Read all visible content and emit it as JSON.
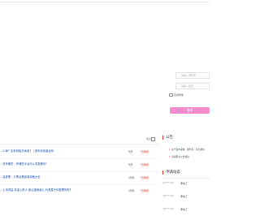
{
  "login": {
    "username_placeholder": "请输入手机号",
    "password_placeholder": "请输入密码",
    "remember_label": "自动登录",
    "login_button": "登录"
  },
  "list": {
    "more_label": "更多",
    "rows": [
      {
        "title": "…么单？如何领取手续费？ | 发布商务撮合网",
        "meta": "",
        "points": "5分",
        "status": "已采纳"
      },
      {
        "title": "…学有哪些，有哪些平台可以发表期刊？",
        "meta": "",
        "points": "5分",
        "status": "已采纳"
      },
      {
        "title": "…高铁票，订票必看官网攻略大全",
        "meta": "",
        "points": "10分",
        "status": "已采纳"
      },
      {
        "title": "…土务供给,发者入职人,都让团销费心,代表属于你整理的呢？",
        "meta": "",
        "points": "10分",
        "status": "已采纳"
      }
    ]
  },
  "announcements": {
    "title": "公告",
    "items": [
      "关于发布采购、服务等…平台通知",
      "商家服务公告通知"
    ]
  },
  "applications": {
    "title": "申请动态",
    "rows": [
      {
        "date": "126****100",
        "text": "申请了"
      },
      {
        "date": "136****183",
        "text": "申请了"
      },
      {
        "date": "136****166",
        "text": "申请了"
      }
    ]
  },
  "colors": {
    "accent": "#f28ccc",
    "status": "#e0301e",
    "link": "#1a4ea8"
  }
}
